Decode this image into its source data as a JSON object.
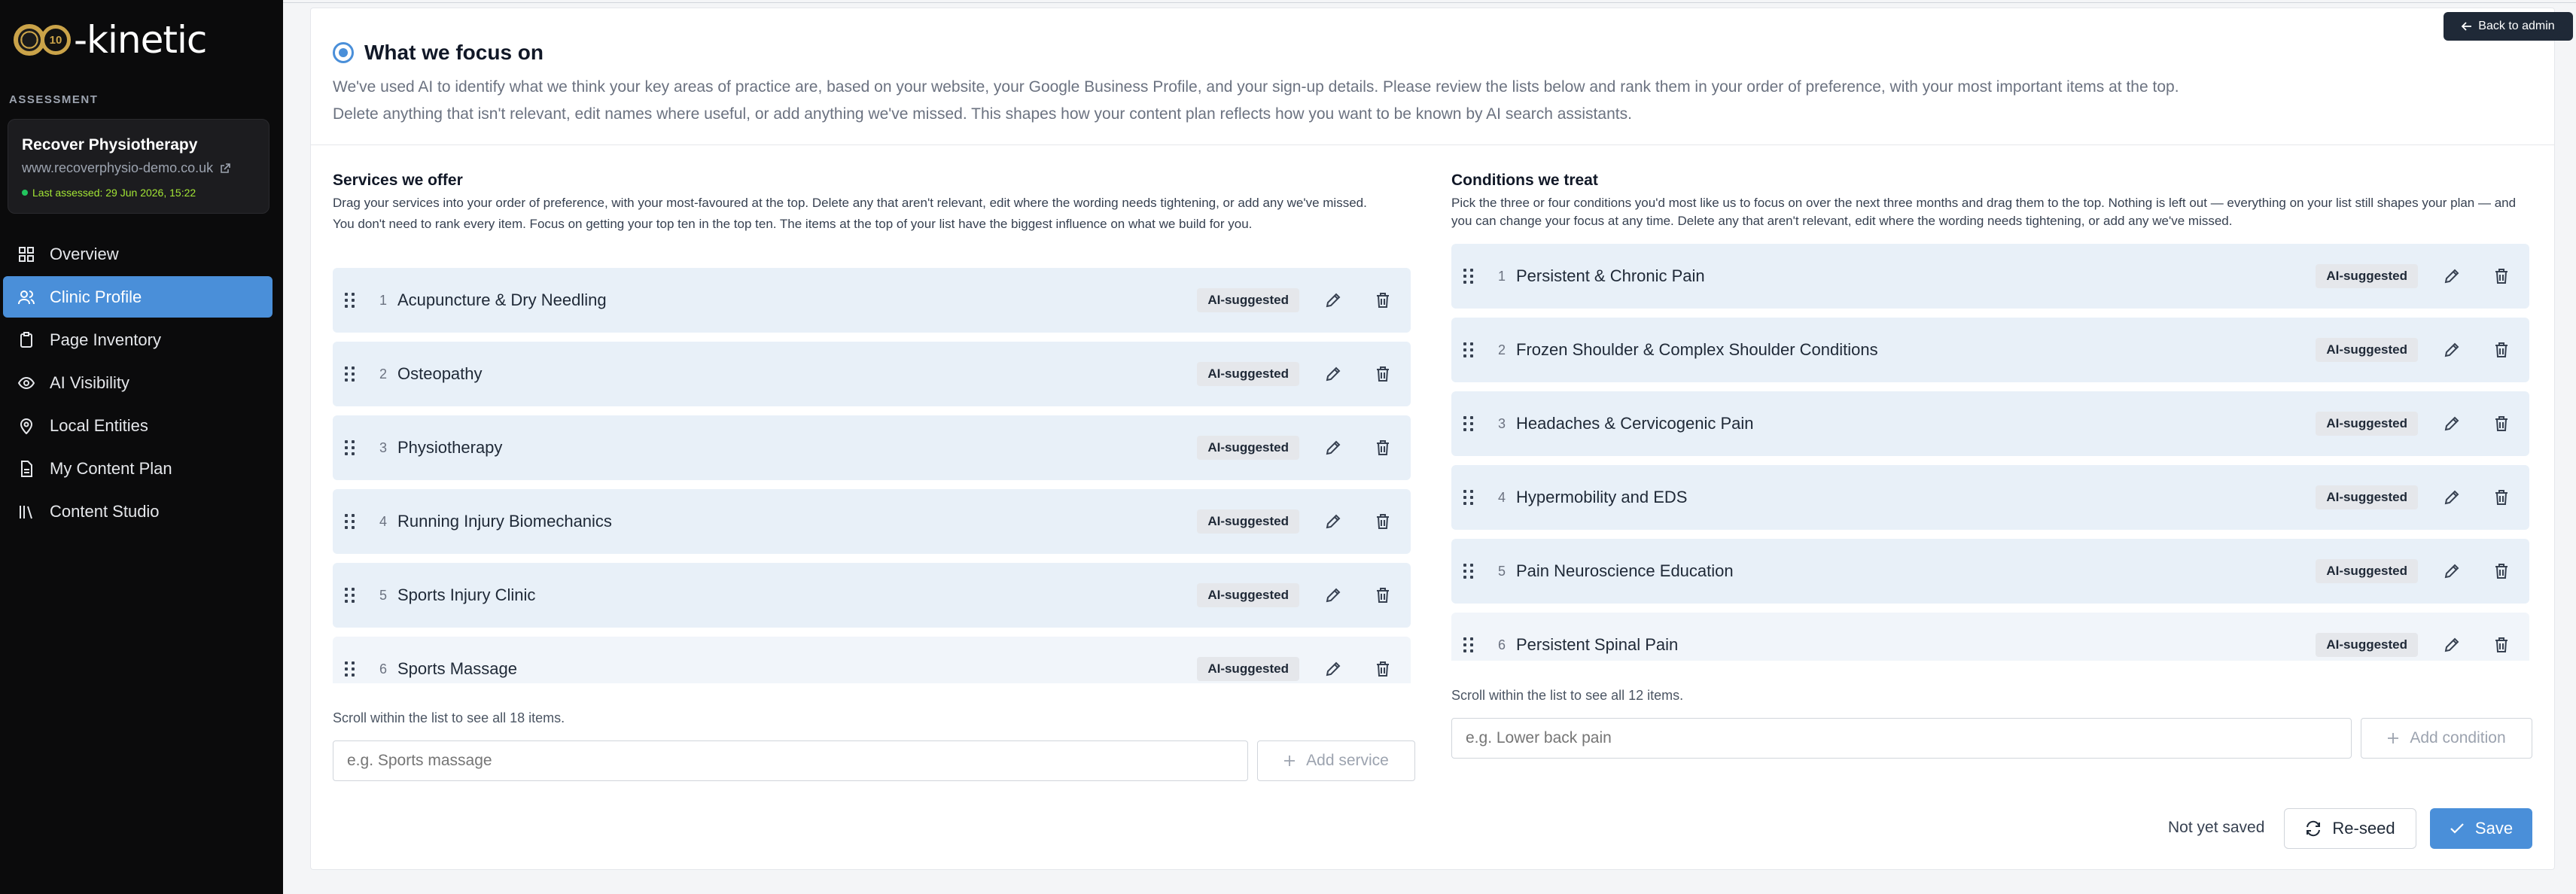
{
  "brand": {
    "logo_text": "-kinetic",
    "logo_badge": "10"
  },
  "sidebar": {
    "section_label": "ASSESSMENT",
    "site": {
      "name": "Recover Physiotherapy",
      "url": "www.recoverphysio-demo.co.uk",
      "status": "Last assessed: 29 Jun 2026, 15:22"
    },
    "items": [
      {
        "label": "Overview",
        "icon": "grid-icon"
      },
      {
        "label": "Clinic Profile",
        "icon": "users-icon",
        "active": true
      },
      {
        "label": "Page Inventory",
        "icon": "clipboard-icon"
      },
      {
        "label": "AI Visibility",
        "icon": "eye-icon"
      },
      {
        "label": "Local Entities",
        "icon": "map-pin-icon"
      },
      {
        "label": "My Content Plan",
        "icon": "file-icon"
      },
      {
        "label": "Content Studio",
        "icon": "library-icon"
      }
    ]
  },
  "header": {
    "back_label": "Back to admin",
    "title": "What we focus on",
    "intro_1": "We've used AI to identify what we think your key areas of practice are, based on your website, your Google Business Profile, and your sign-up details. Please review the lists below and rank them in your order of preference, with your most important items at the top.",
    "intro_2": "Delete anything that isn't relevant, edit names where useful, or add anything we've missed. This shapes how your content plan reflects how you want to be known by AI search assistants."
  },
  "services": {
    "title": "Services we offer",
    "desc_1": "Drag your services into your order of preference, with your most-favoured at the top. Delete any that aren't relevant, edit where the wording needs tightening, or add any we've missed.",
    "desc_2": "You don't need to rank every item. Focus on getting your top ten in the top ten. The items at the top of your list have the biggest influence on what we build for you.",
    "items": [
      {
        "rank": "1",
        "name": "Acupuncture & Dry Needling",
        "badge": "AI-suggested"
      },
      {
        "rank": "2",
        "name": "Osteopathy",
        "badge": "AI-suggested"
      },
      {
        "rank": "3",
        "name": "Physiotherapy",
        "badge": "AI-suggested"
      },
      {
        "rank": "4",
        "name": "Running Injury Biomechanics",
        "badge": "AI-suggested"
      },
      {
        "rank": "5",
        "name": "Sports Injury Clinic",
        "badge": "AI-suggested"
      },
      {
        "rank": "6",
        "name": "Sports Massage",
        "badge": "AI-suggested"
      }
    ],
    "scroll_note": "Scroll within the list to see all 18 items.",
    "input_placeholder": "e.g. Sports massage",
    "add_label": "Add service"
  },
  "conditions": {
    "title": "Conditions we treat",
    "desc_1": "Pick the three or four conditions you'd most like us to focus on over the next three months and drag them to the top. Nothing is left out — everything on your list still shapes your plan — and you can change your focus at any time. Delete any that aren't relevant, edit where the wording needs tightening, or add any we've missed.",
    "items": [
      {
        "rank": "1",
        "name": "Persistent & Chronic Pain",
        "badge": "AI-suggested"
      },
      {
        "rank": "2",
        "name": "Frozen Shoulder & Complex Shoulder Conditions",
        "badge": "AI-suggested"
      },
      {
        "rank": "3",
        "name": "Headaches & Cervicogenic Pain",
        "badge": "AI-suggested"
      },
      {
        "rank": "4",
        "name": "Hypermobility and EDS",
        "badge": "AI-suggested"
      },
      {
        "rank": "5",
        "name": "Pain Neuroscience Education",
        "badge": "AI-suggested"
      },
      {
        "rank": "6",
        "name": "Persistent Spinal Pain",
        "badge": "AI-suggested"
      }
    ],
    "scroll_note": "Scroll within the list to see all 12 items.",
    "input_placeholder": "e.g. Lower back pain",
    "add_label": "Add condition"
  },
  "footer": {
    "status": "Not yet saved",
    "reseed_label": "Re-seed",
    "save_label": "Save"
  }
}
